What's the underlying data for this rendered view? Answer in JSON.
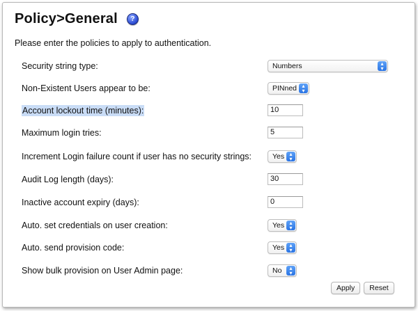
{
  "page": {
    "title": "Policy>General",
    "intro": "Please enter the policies to apply to authentication."
  },
  "fields": [
    {
      "label": "Security string type:",
      "type": "select",
      "value": "Numbers",
      "highlight": false
    },
    {
      "label": "Non-Existent Users appear to be:",
      "type": "select",
      "value": "PINned",
      "highlight": false
    },
    {
      "label": "Account lockout time (minutes):",
      "type": "input",
      "value": "10",
      "highlight": true
    },
    {
      "label": "Maximum login tries:",
      "type": "input",
      "value": "5",
      "highlight": false
    },
    {
      "label": "Increment Login failure count if user has no security strings:",
      "type": "select",
      "value": "Yes",
      "highlight": false
    },
    {
      "label": "Audit Log length (days):",
      "type": "input",
      "value": "30",
      "highlight": false
    },
    {
      "label": "Inactive account expiry (days):",
      "type": "input",
      "value": "0",
      "highlight": false
    },
    {
      "label": "Auto. set credentials on user creation:",
      "type": "select",
      "value": "Yes",
      "highlight": false
    },
    {
      "label": "Auto. send provision code:",
      "type": "select",
      "value": "Yes",
      "highlight": false
    },
    {
      "label": "Show bulk provision on User Admin page:",
      "type": "select",
      "value": "No",
      "highlight": false
    }
  ],
  "buttons": {
    "apply": "Apply",
    "reset": "Reset"
  },
  "icons": {
    "help": "question-mark-help-icon",
    "dropdown": "chevron-up-down-icon"
  },
  "colors": {
    "highlight": "#c9dcf6",
    "select_accent": "#2a74e4"
  }
}
